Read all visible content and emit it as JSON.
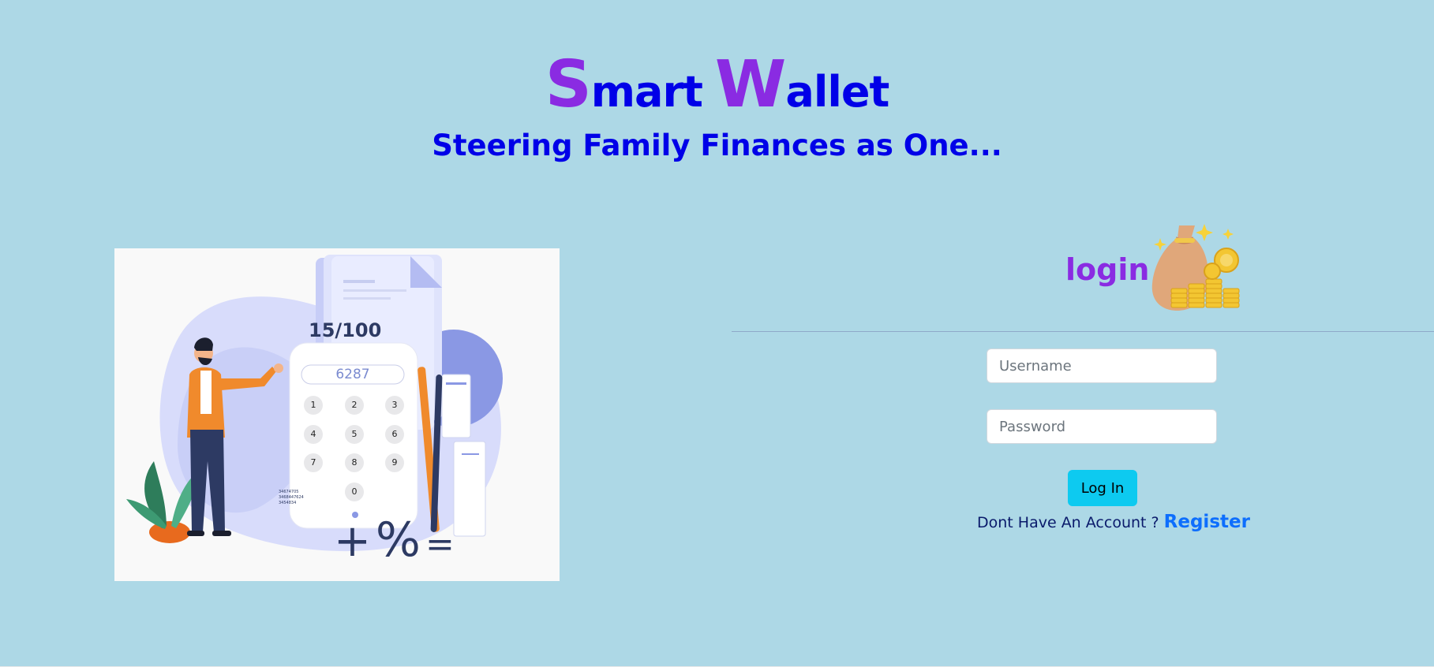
{
  "brand": {
    "word1_initial": "S",
    "word1_rest": "mart",
    "word2_initial": "W",
    "word2_rest": "allet"
  },
  "tagline": "Steering Family Finances as One...",
  "hero": {
    "score": "15/100",
    "calculator_display": "6287",
    "keys": [
      "1",
      "2",
      "3",
      "4",
      "5",
      "6",
      "7",
      "8",
      "9",
      "0"
    ],
    "operators": [
      "+",
      "%",
      "="
    ],
    "icon": "finance-calculator-illustration"
  },
  "login": {
    "heading": "login",
    "icon": "money-bag-icon",
    "username_placeholder": "Username",
    "password_placeholder": "Password",
    "submit_label": "Log In",
    "no_account_text": "Dont Have An Account ?",
    "register_link": "Register"
  },
  "colors": {
    "background": "#add8e6",
    "brand_purple": "#8a2be2",
    "brand_blue": "#0000e8",
    "button": "#0dcaf0",
    "link": "#0d6efd"
  }
}
